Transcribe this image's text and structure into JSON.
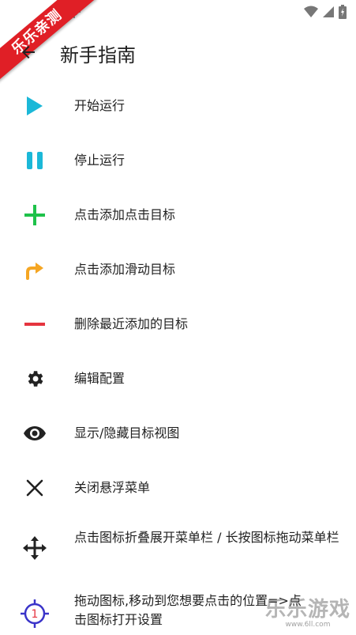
{
  "ribbon": {
    "text": "乐乐亲测"
  },
  "header": {
    "title": "新手指南"
  },
  "items": [
    {
      "label": "开始运行",
      "icon": "play-icon",
      "color": "#1bb8d8"
    },
    {
      "label": "停止运行",
      "icon": "pause-icon",
      "color": "#1bb8d8"
    },
    {
      "label": "点击添加点击目标",
      "icon": "plus-icon",
      "color": "#1ec24a"
    },
    {
      "label": "点击添加滑动目标",
      "icon": "swipe-arrow-icon",
      "color": "#f5a623"
    },
    {
      "label": "删除最近添加的目标",
      "icon": "minus-icon",
      "color": "#e5343f"
    },
    {
      "label": "编辑配置",
      "icon": "gear-icon",
      "color": "#222222"
    },
    {
      "label": "显示/隐藏目标视图",
      "icon": "eye-icon",
      "color": "#222222"
    },
    {
      "label": "关闭悬浮菜单",
      "icon": "close-icon",
      "color": "#222222"
    },
    {
      "label": "点击图标折叠展开菜单栏 / 长按图标拖动菜单栏",
      "icon": "move-icon",
      "color": "#222222"
    },
    {
      "label": "拖动图标,移动到您想要点击的位置=>点击图标打开设置",
      "icon": "target-icon",
      "color": "#3a34c9"
    }
  ],
  "target_badge": "1",
  "watermark": {
    "main": "乐乐游戏",
    "url": "www.6ll.com"
  }
}
